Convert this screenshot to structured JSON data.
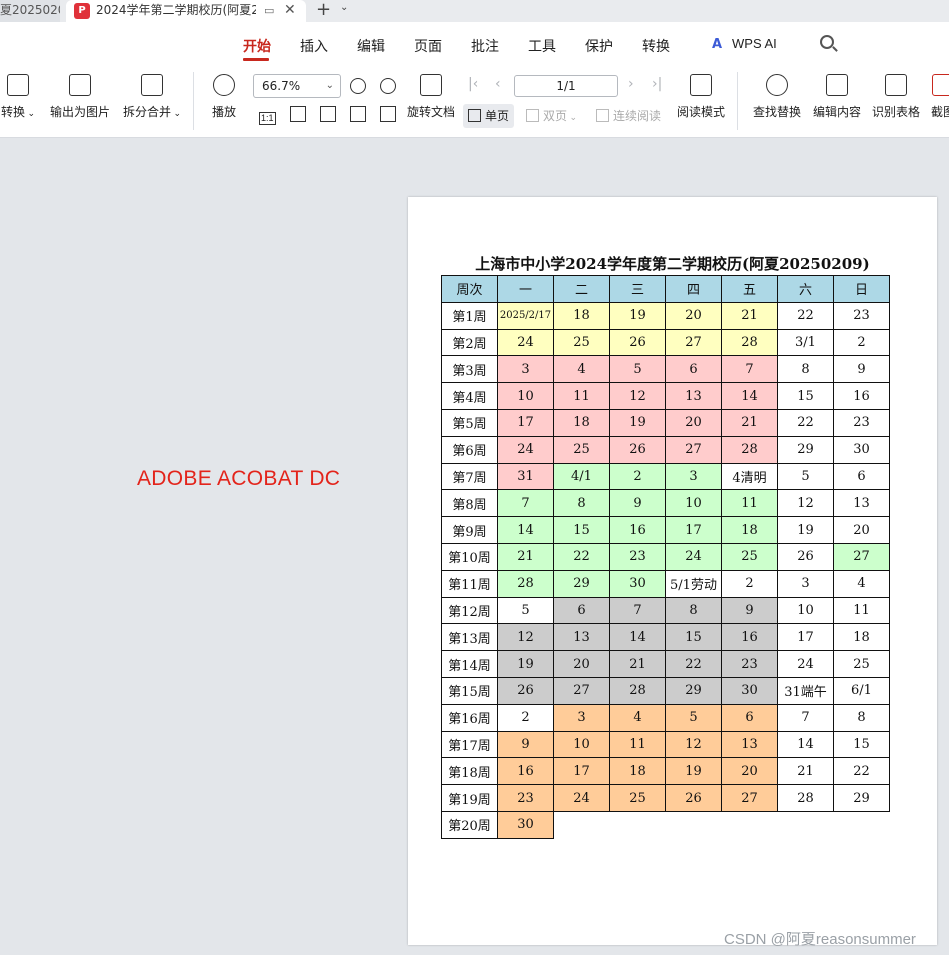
{
  "tabs": [
    {
      "label": "夏2025020",
      "active": false
    },
    {
      "label": "2024学年第二学期校历(阿夏2025",
      "active": true
    }
  ],
  "menu": {
    "items": [
      "开始",
      "插入",
      "编辑",
      "页面",
      "批注",
      "工具",
      "保护",
      "转换"
    ],
    "active": "开始",
    "wps_ai": "WPS AI"
  },
  "toolbar": {
    "convert": "转换",
    "export_image": "输出为图片",
    "split_merge": "拆分合并",
    "play": "播放",
    "zoom": "66.7%",
    "actual_size": "1:1",
    "rotate_doc": "旋转文档",
    "page_indicator": "1/1",
    "single_page": "单页",
    "double_page": "双页",
    "continuous": "连续阅读",
    "read_mode": "阅读模式",
    "find_replace": "查找替换",
    "edit_content": "编辑内容",
    "recognize_table": "识别表格",
    "screenshot": "截图"
  },
  "overlay_text": "ADOBE ACOBAT DC",
  "calendar": {
    "title": "上海市中小学2024学年度第二学期校历(阿夏20250209)",
    "headers": [
      "周次",
      "一",
      "二",
      "三",
      "四",
      "五",
      "六",
      "日"
    ],
    "rows": [
      {
        "week": "第1周",
        "cells": [
          [
            "2025/2/17",
            "y"
          ],
          [
            "18",
            "y"
          ],
          [
            "19",
            "y"
          ],
          [
            "20",
            "y"
          ],
          [
            "21",
            "y"
          ],
          [
            "22",
            "w"
          ],
          [
            "23",
            "w"
          ]
        ]
      },
      {
        "week": "第2周",
        "cells": [
          [
            "24",
            "y"
          ],
          [
            "25",
            "y"
          ],
          [
            "26",
            "y"
          ],
          [
            "27",
            "y"
          ],
          [
            "28",
            "y"
          ],
          [
            "3/1",
            "w"
          ],
          [
            "2",
            "w"
          ]
        ]
      },
      {
        "week": "第3周",
        "cells": [
          [
            "3",
            "p"
          ],
          [
            "4",
            "p"
          ],
          [
            "5",
            "p"
          ],
          [
            "6",
            "p"
          ],
          [
            "7",
            "p"
          ],
          [
            "8",
            "w"
          ],
          [
            "9",
            "w"
          ]
        ]
      },
      {
        "week": "第4周",
        "cells": [
          [
            "10",
            "p"
          ],
          [
            "11",
            "p"
          ],
          [
            "12",
            "p"
          ],
          [
            "13",
            "p"
          ],
          [
            "14",
            "p"
          ],
          [
            "15",
            "w"
          ],
          [
            "16",
            "w"
          ]
        ]
      },
      {
        "week": "第5周",
        "cells": [
          [
            "17",
            "p"
          ],
          [
            "18",
            "p"
          ],
          [
            "19",
            "p"
          ],
          [
            "20",
            "p"
          ],
          [
            "21",
            "p"
          ],
          [
            "22",
            "w"
          ],
          [
            "23",
            "w"
          ]
        ]
      },
      {
        "week": "第6周",
        "cells": [
          [
            "24",
            "p"
          ],
          [
            "25",
            "p"
          ],
          [
            "26",
            "p"
          ],
          [
            "27",
            "p"
          ],
          [
            "28",
            "p"
          ],
          [
            "29",
            "w"
          ],
          [
            "30",
            "w"
          ]
        ]
      },
      {
        "week": "第7周",
        "cells": [
          [
            "31",
            "p"
          ],
          [
            "4/1",
            "g"
          ],
          [
            "2",
            "g"
          ],
          [
            "3",
            "g"
          ],
          [
            "4清明",
            "w"
          ],
          [
            "5",
            "w"
          ],
          [
            "6",
            "w"
          ]
        ]
      },
      {
        "week": "第8周",
        "cells": [
          [
            "7",
            "g"
          ],
          [
            "8",
            "g"
          ],
          [
            "9",
            "g"
          ],
          [
            "10",
            "g"
          ],
          [
            "11",
            "g"
          ],
          [
            "12",
            "w"
          ],
          [
            "13",
            "w"
          ]
        ]
      },
      {
        "week": "第9周",
        "cells": [
          [
            "14",
            "g"
          ],
          [
            "15",
            "g"
          ],
          [
            "16",
            "g"
          ],
          [
            "17",
            "g"
          ],
          [
            "18",
            "g"
          ],
          [
            "19",
            "w"
          ],
          [
            "20",
            "w"
          ]
        ]
      },
      {
        "week": "第10周",
        "cells": [
          [
            "21",
            "g"
          ],
          [
            "22",
            "g"
          ],
          [
            "23",
            "g"
          ],
          [
            "24",
            "g"
          ],
          [
            "25",
            "g"
          ],
          [
            "26",
            "w"
          ],
          [
            "27",
            "g"
          ]
        ]
      },
      {
        "week": "第11周",
        "cells": [
          [
            "28",
            "g"
          ],
          [
            "29",
            "g"
          ],
          [
            "30",
            "g"
          ],
          [
            "5/1劳动",
            "w"
          ],
          [
            "2",
            "w"
          ],
          [
            "3",
            "w"
          ],
          [
            "4",
            "w"
          ]
        ]
      },
      {
        "week": "第12周",
        "cells": [
          [
            "5",
            "w"
          ],
          [
            "6",
            "gr"
          ],
          [
            "7",
            "gr"
          ],
          [
            "8",
            "gr"
          ],
          [
            "9",
            "gr"
          ],
          [
            "10",
            "w"
          ],
          [
            "11",
            "w"
          ]
        ]
      },
      {
        "week": "第13周",
        "cells": [
          [
            "12",
            "gr"
          ],
          [
            "13",
            "gr"
          ],
          [
            "14",
            "gr"
          ],
          [
            "15",
            "gr"
          ],
          [
            "16",
            "gr"
          ],
          [
            "17",
            "w"
          ],
          [
            "18",
            "w"
          ]
        ]
      },
      {
        "week": "第14周",
        "cells": [
          [
            "19",
            "gr"
          ],
          [
            "20",
            "gr"
          ],
          [
            "21",
            "gr"
          ],
          [
            "22",
            "gr"
          ],
          [
            "23",
            "gr"
          ],
          [
            "24",
            "w"
          ],
          [
            "25",
            "w"
          ]
        ]
      },
      {
        "week": "第15周",
        "cells": [
          [
            "26",
            "gr"
          ],
          [
            "27",
            "gr"
          ],
          [
            "28",
            "gr"
          ],
          [
            "29",
            "gr"
          ],
          [
            "30",
            "gr"
          ],
          [
            "31端午",
            "w"
          ],
          [
            "6/1",
            "w"
          ]
        ]
      },
      {
        "week": "第16周",
        "cells": [
          [
            "2",
            "w"
          ],
          [
            "3",
            "o"
          ],
          [
            "4",
            "o"
          ],
          [
            "5",
            "o"
          ],
          [
            "6",
            "o"
          ],
          [
            "7",
            "w"
          ],
          [
            "8",
            "w"
          ]
        ]
      },
      {
        "week": "第17周",
        "cells": [
          [
            "9",
            "o"
          ],
          [
            "10",
            "o"
          ],
          [
            "11",
            "o"
          ],
          [
            "12",
            "o"
          ],
          [
            "13",
            "o"
          ],
          [
            "14",
            "w"
          ],
          [
            "15",
            "w"
          ]
        ]
      },
      {
        "week": "第18周",
        "cells": [
          [
            "16",
            "o"
          ],
          [
            "17",
            "o"
          ],
          [
            "18",
            "o"
          ],
          [
            "19",
            "o"
          ],
          [
            "20",
            "o"
          ],
          [
            "21",
            "w"
          ],
          [
            "22",
            "w"
          ]
        ]
      },
      {
        "week": "第19周",
        "cells": [
          [
            "23",
            "o"
          ],
          [
            "24",
            "o"
          ],
          [
            "25",
            "o"
          ],
          [
            "26",
            "o"
          ],
          [
            "27",
            "o"
          ],
          [
            "28",
            "w"
          ],
          [
            "29",
            "w"
          ]
        ]
      },
      {
        "week": "第20周",
        "cells": [
          [
            "30",
            "o"
          ]
        ]
      }
    ],
    "colors": {
      "header": "#add8e6",
      "y": "#ffffc0",
      "p": "#ffcccc",
      "g": "#ccffcc",
      "gr": "#cccccc",
      "o": "#ffcc99",
      "w": "#ffffff"
    }
  },
  "watermark": "CSDN @阿夏reasonsummer"
}
